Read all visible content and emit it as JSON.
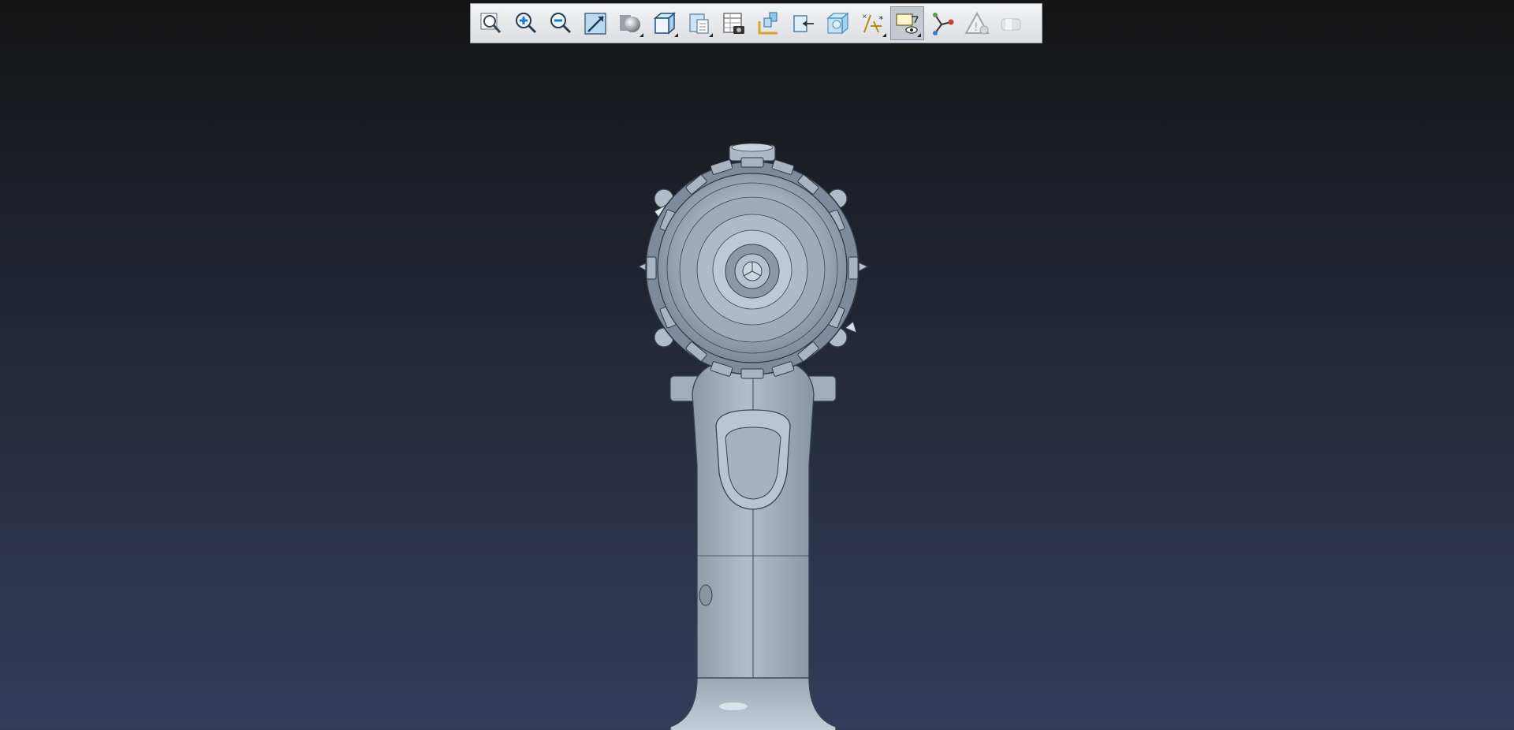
{
  "toolbar": {
    "buttons": [
      {
        "id": "zoom-fit",
        "icon": "magnifier-icon",
        "flyout": false,
        "active": false
      },
      {
        "id": "zoom-in",
        "icon": "zoom-in-icon",
        "flyout": false,
        "active": false
      },
      {
        "id": "zoom-out",
        "icon": "zoom-out-icon",
        "flyout": false,
        "active": false
      },
      {
        "id": "zoom-window",
        "icon": "zoom-window-icon",
        "flyout": false,
        "active": false
      },
      {
        "id": "display-style",
        "icon": "shaded-sphere-icon",
        "flyout": true,
        "active": false
      },
      {
        "id": "view-orientation",
        "icon": "cube-view-icon",
        "flyout": true,
        "active": false
      },
      {
        "id": "view-manager",
        "icon": "view-manager-icon",
        "flyout": true,
        "active": false
      },
      {
        "id": "snapshot",
        "icon": "table-camera-icon",
        "flyout": false,
        "active": false
      },
      {
        "id": "explode",
        "icon": "explode-parts-icon",
        "flyout": false,
        "active": false
      },
      {
        "id": "section",
        "icon": "section-arrow-icon",
        "flyout": false,
        "active": false
      },
      {
        "id": "transparency",
        "icon": "glass-cube-icon",
        "flyout": false,
        "active": false
      },
      {
        "id": "datum-display",
        "icon": "datum-axes-icon",
        "flyout": true,
        "active": false
      },
      {
        "id": "annotation-display",
        "icon": "annotation-eye-icon",
        "flyout": true,
        "active": true
      },
      {
        "id": "connections",
        "icon": "connection-nodes-icon",
        "flyout": false,
        "active": false
      },
      {
        "id": "warning",
        "icon": "warning-triangle-icon",
        "flyout": false,
        "active": false
      },
      {
        "id": "shading-disabled",
        "icon": "disabled-shape-icon",
        "flyout": false,
        "active": false
      }
    ]
  },
  "colors": {
    "background_top": "#141414",
    "background_bottom": "#353c5a",
    "model_fill": "#a8b3c2",
    "model_edge": "#3a4250",
    "toolbar_bg": "#e6e8eb",
    "active_button": "#c4c8cf"
  }
}
